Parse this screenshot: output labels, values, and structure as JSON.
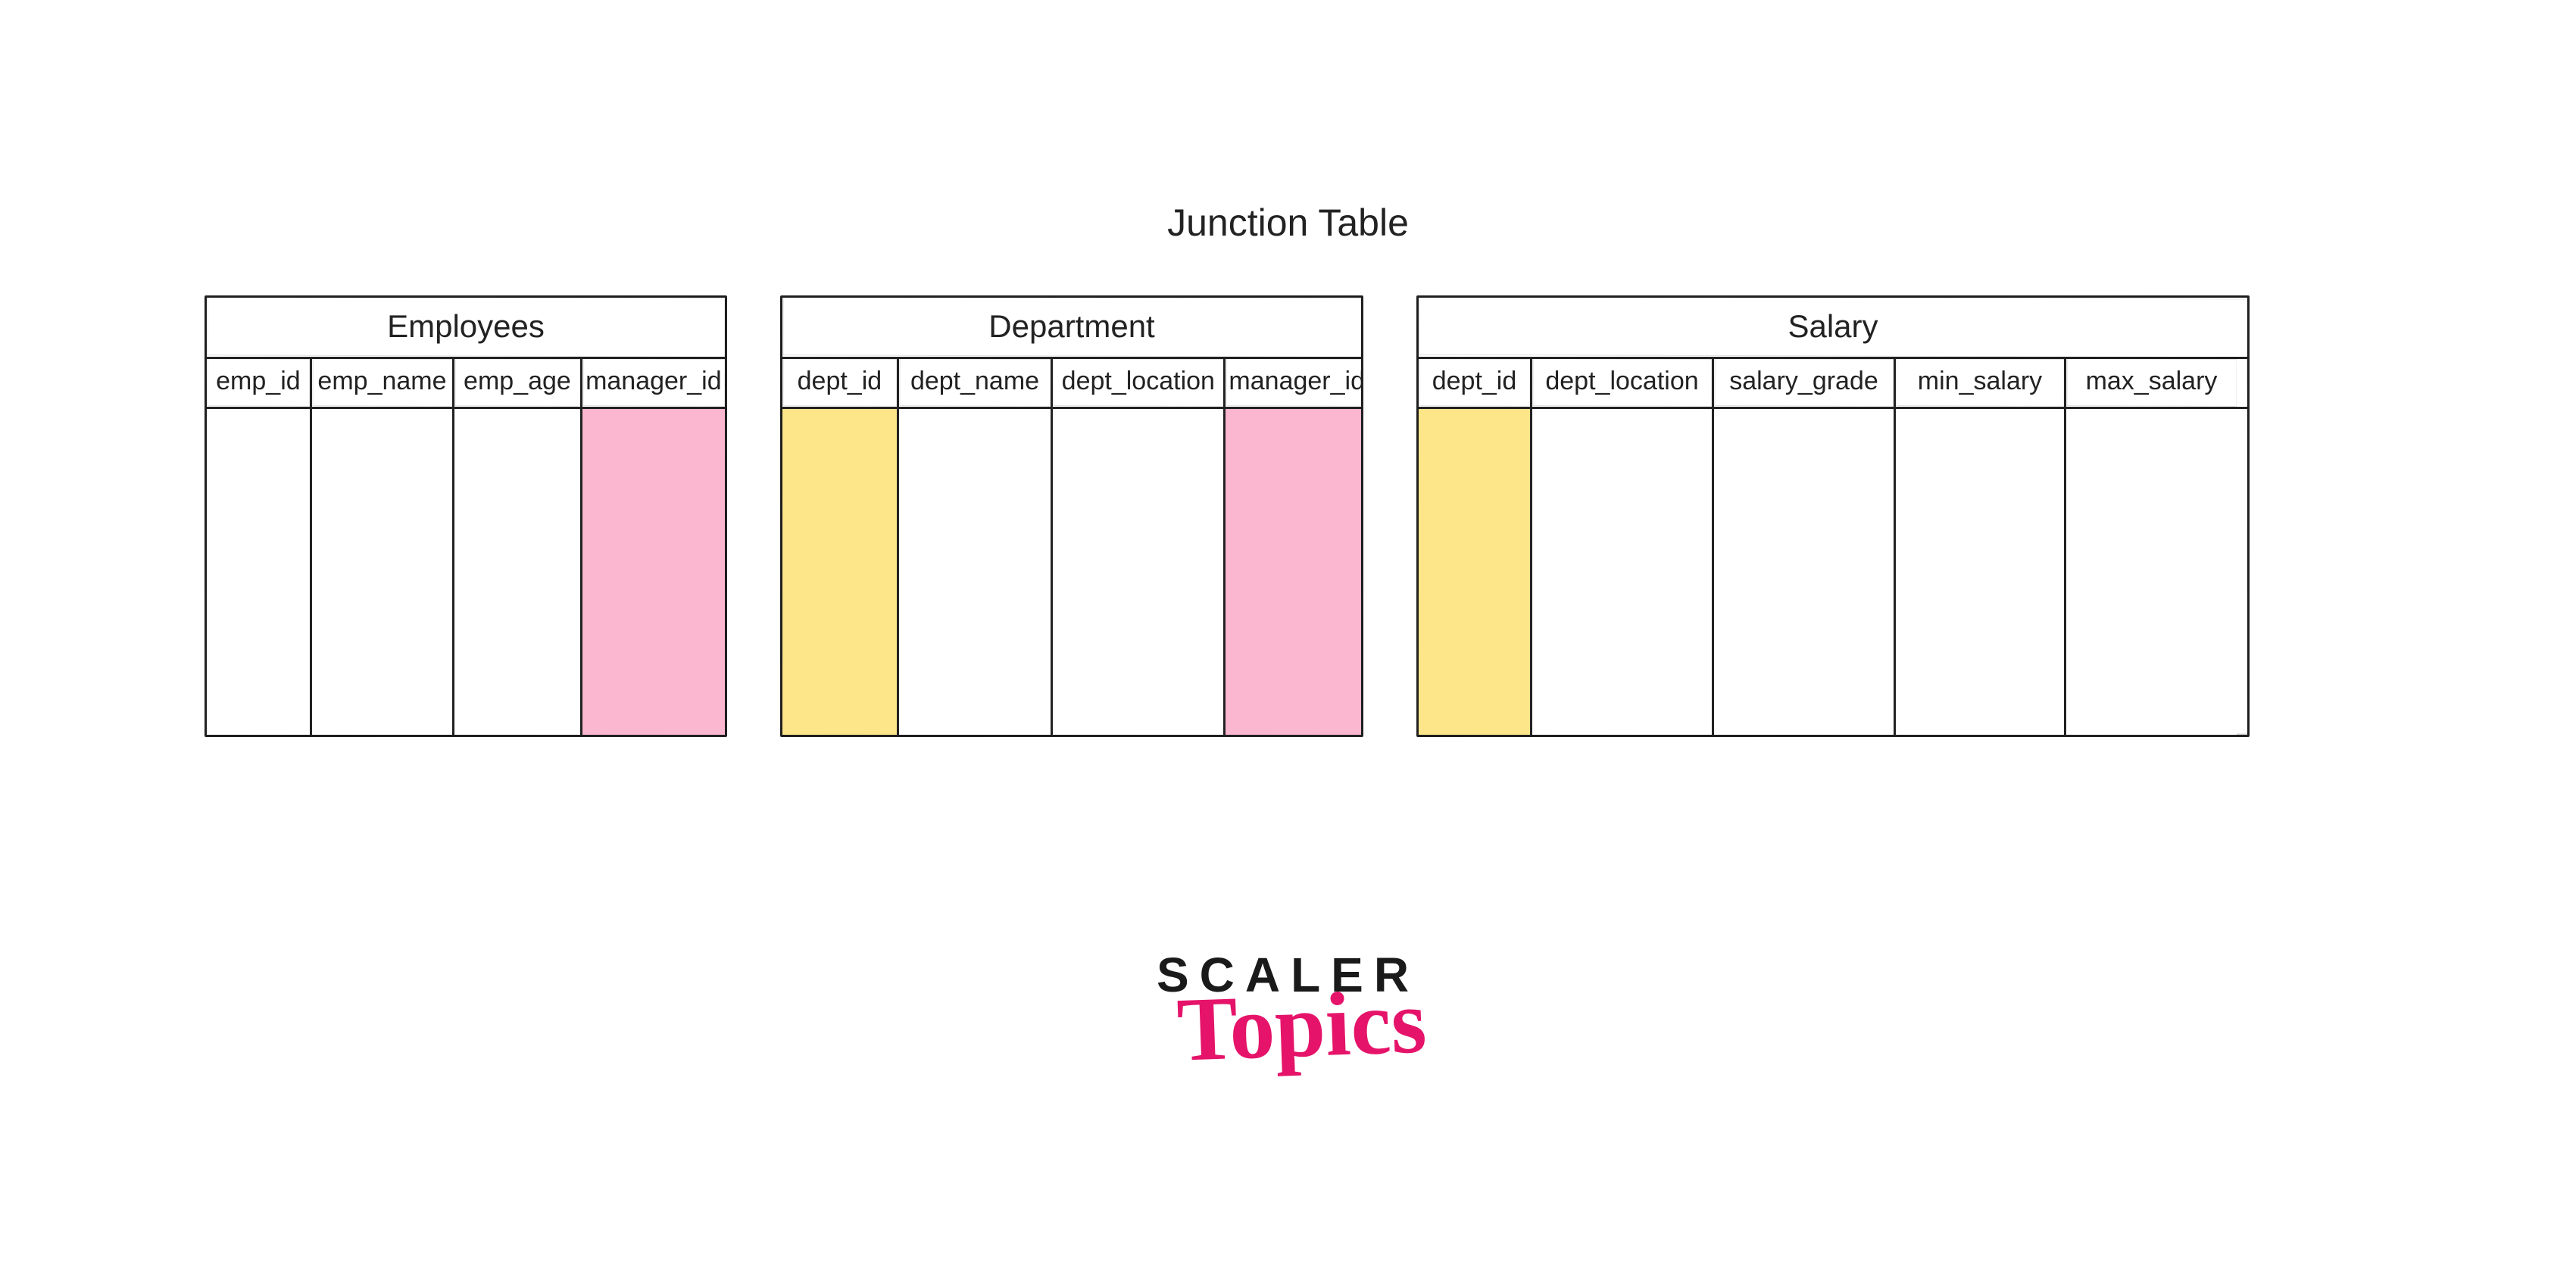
{
  "title": "Junction Table",
  "colors": {
    "pink": "#fbb7cf",
    "yellow": "#fde58a",
    "ink": "#222222"
  },
  "tables": [
    {
      "name": "Employees",
      "columns": [
        {
          "label": "emp_id",
          "highlight": "none"
        },
        {
          "label": "emp_name",
          "highlight": "none"
        },
        {
          "label": "emp_age",
          "highlight": "none"
        },
        {
          "label": "manager_id",
          "highlight": "pink"
        }
      ]
    },
    {
      "name": "Department",
      "columns": [
        {
          "label": "dept_id",
          "highlight": "yellow"
        },
        {
          "label": "dept_name",
          "highlight": "none"
        },
        {
          "label": "dept_location",
          "highlight": "none"
        },
        {
          "label": "manager_id",
          "highlight": "pink"
        }
      ]
    },
    {
      "name": "Salary",
      "columns": [
        {
          "label": "dept_id",
          "highlight": "yellow"
        },
        {
          "label": "dept_location",
          "highlight": "none"
        },
        {
          "label": "salary_grade",
          "highlight": "none"
        },
        {
          "label": "min_salary",
          "highlight": "none"
        },
        {
          "label": "max_salary",
          "highlight": "none"
        }
      ]
    }
  ],
  "logo": {
    "line1": "SCALER",
    "line2": "Topics"
  }
}
